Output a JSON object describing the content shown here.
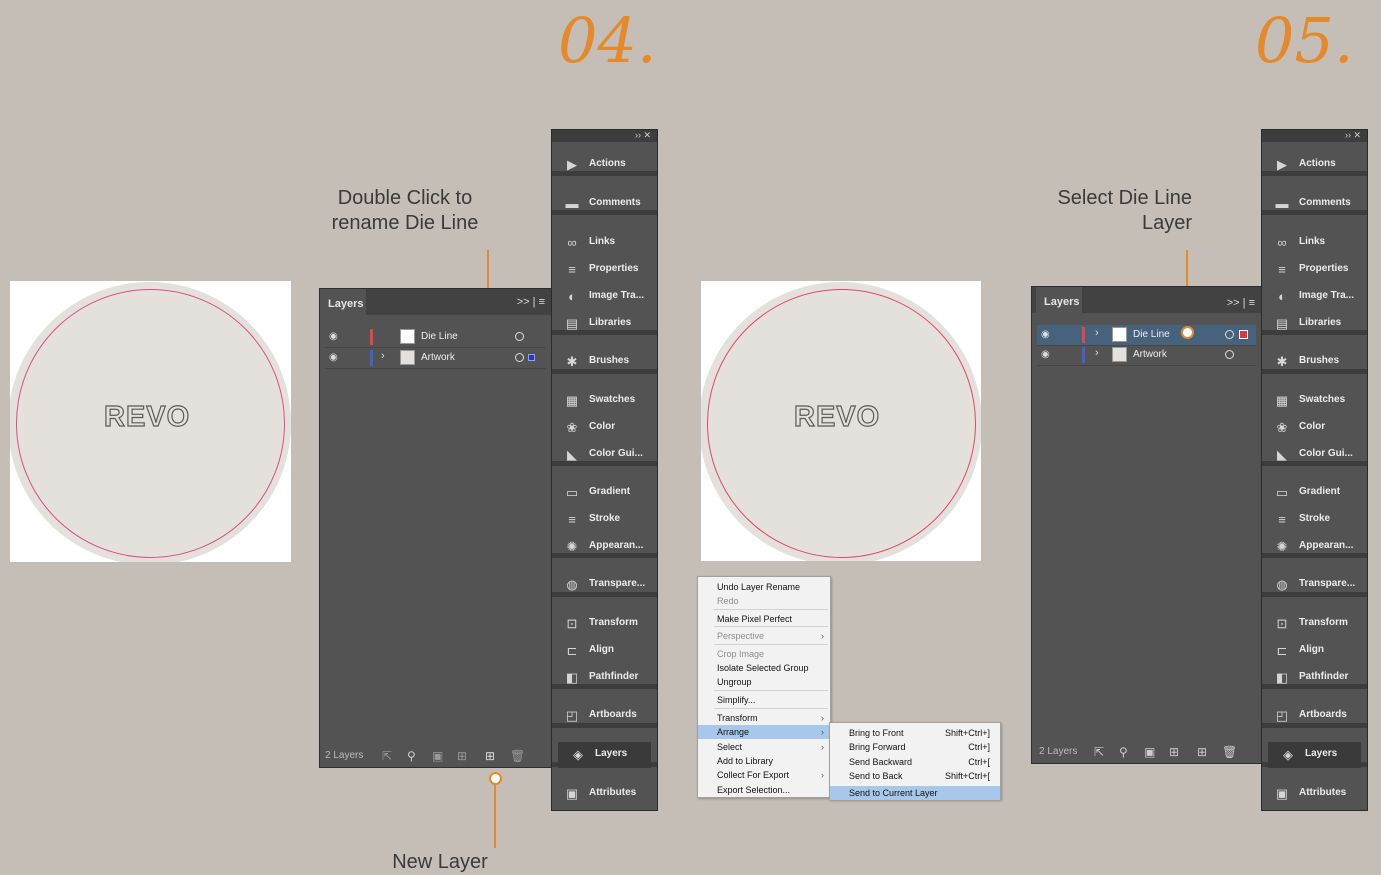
{
  "steps": {
    "left": "04.",
    "right": "05."
  },
  "annotations": {
    "rename": "Double Click to\nrename Die Line",
    "select": "Select Die Line\nLayer",
    "new_layer": "New Layer"
  },
  "artboard": {
    "logo_text": "REVO"
  },
  "layers_panel": {
    "tab": "Layers",
    "controls": ">> | ≡",
    "footer_count": "2 Layers",
    "rows": [
      {
        "name": "Die Line",
        "color": "#e04848"
      },
      {
        "name": "Artwork",
        "color": "#4a5fc4"
      }
    ]
  },
  "dock": {
    "top_controls": "›› ✕",
    "items": [
      {
        "label": "Actions",
        "icon": "play-icon"
      },
      {
        "label": "Comments",
        "icon": "comment-icon"
      },
      {
        "label": "Links",
        "icon": "link-icon"
      },
      {
        "label": "Properties",
        "icon": "sliders-icon"
      },
      {
        "label": "Image Tra...",
        "icon": "image-trace-icon"
      },
      {
        "label": "Libraries",
        "icon": "library-icon"
      },
      {
        "label": "Brushes",
        "icon": "brush-icon"
      },
      {
        "label": "Swatches",
        "icon": "swatch-icon"
      },
      {
        "label": "Color",
        "icon": "palette-icon"
      },
      {
        "label": "Color Gui...",
        "icon": "color-guide-icon"
      },
      {
        "label": "Gradient",
        "icon": "gradient-icon"
      },
      {
        "label": "Stroke",
        "icon": "stroke-icon"
      },
      {
        "label": "Appearan...",
        "icon": "appearance-icon"
      },
      {
        "label": "Transpare...",
        "icon": "transparency-icon"
      },
      {
        "label": "Transform",
        "icon": "transform-icon"
      },
      {
        "label": "Align",
        "icon": "align-icon"
      },
      {
        "label": "Pathfinder",
        "icon": "pathfinder-icon"
      },
      {
        "label": "Artboards",
        "icon": "artboard-icon"
      },
      {
        "label": "Layers",
        "icon": "layers-icon"
      },
      {
        "label": "Attributes",
        "icon": "attributes-icon"
      }
    ]
  },
  "context_menu": {
    "items": [
      {
        "label": "Undo Layer Rename",
        "disabled": false
      },
      {
        "label": "Redo",
        "disabled": true
      },
      {
        "label": "Make Pixel Perfect",
        "disabled": false
      },
      {
        "label": "Perspective",
        "disabled": true,
        "submenu": true
      },
      {
        "label": "Crop Image",
        "disabled": true
      },
      {
        "label": "Isolate Selected Group",
        "disabled": false
      },
      {
        "label": "Ungroup",
        "disabled": false
      },
      {
        "label": "Simplify...",
        "disabled": false
      },
      {
        "label": "Transform",
        "disabled": false,
        "submenu": true
      },
      {
        "label": "Arrange",
        "disabled": false,
        "submenu": true,
        "highlighted": true
      },
      {
        "label": "Select",
        "disabled": false,
        "submenu": true
      },
      {
        "label": "Add to Library",
        "disabled": false
      },
      {
        "label": "Collect For Export",
        "disabled": false,
        "submenu": true
      },
      {
        "label": "Export Selection...",
        "disabled": false
      }
    ],
    "submenu": [
      {
        "label": "Bring to Front",
        "shortcut": "Shift+Ctrl+]"
      },
      {
        "label": "Bring Forward",
        "shortcut": "Ctrl+]"
      },
      {
        "label": "Send Backward",
        "shortcut": "Ctrl+["
      },
      {
        "label": "Send to Back",
        "shortcut": "Shift+Ctrl+["
      },
      {
        "label": "Send to Current Layer",
        "shortcut": "",
        "highlighted": true
      }
    ]
  },
  "colors": {
    "accent": "#e58a2c",
    "panel": "#535353",
    "selection": "#46627d"
  }
}
